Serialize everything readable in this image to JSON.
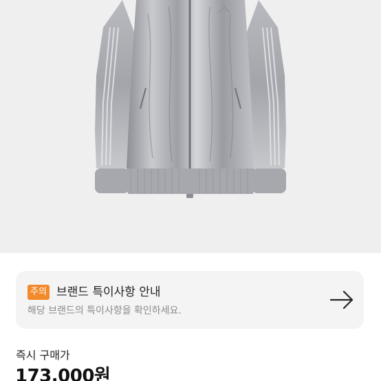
{
  "product": {
    "image_icon": "silver-track-jacket-image"
  },
  "notice": {
    "badge": "주의",
    "title": "브랜드 특이사항 안내",
    "description": "해당 브랜드의 특이사항을 확인하세요.",
    "arrow_icon": "arrow-right-icon",
    "badge_color": "#f2892b"
  },
  "price": {
    "label": "즉시 구매가",
    "value": "173,000원"
  }
}
